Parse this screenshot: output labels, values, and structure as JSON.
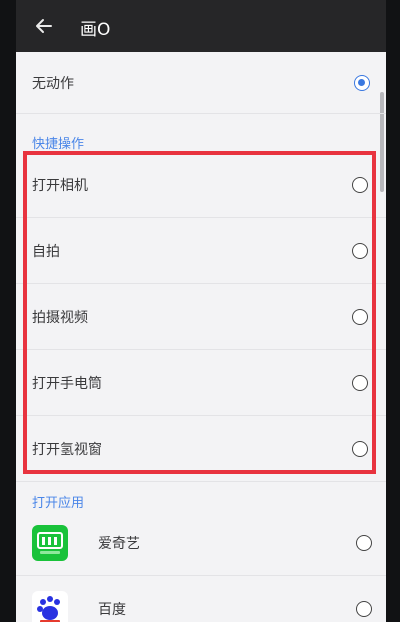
{
  "header": {
    "title": "画O"
  },
  "options": {
    "none_label": "无动作",
    "quick_section": "快捷操作",
    "quick_items": [
      {
        "label": "打开相机"
      },
      {
        "label": "自拍"
      },
      {
        "label": "拍摄视频"
      },
      {
        "label": "打开手电筒"
      },
      {
        "label": "打开氢视窗"
      }
    ],
    "apps_section": "打开应用",
    "apps": [
      {
        "label": "爱奇艺",
        "icon": "iqiyi-icon",
        "color": "#19c23a"
      },
      {
        "label": "百度",
        "icon": "baidu-icon",
        "color": "#2932e1"
      }
    ]
  },
  "colors": {
    "accent": "#3a78e0",
    "highlight": "#e8333f"
  }
}
